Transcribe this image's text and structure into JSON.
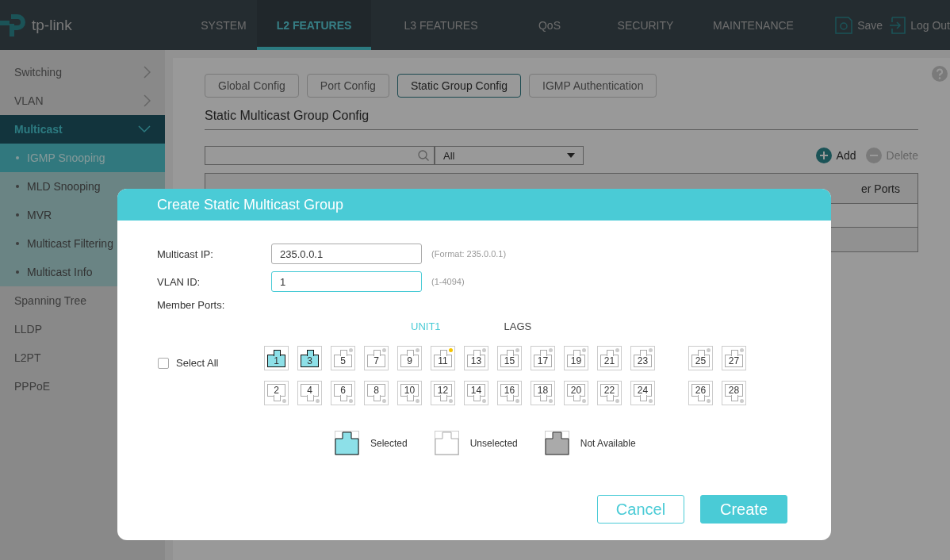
{
  "brand": "tp-link",
  "nav": [
    {
      "label": "SYSTEM",
      "selected": false
    },
    {
      "label": "L2 FEATURES",
      "selected": true
    },
    {
      "label": "L3 FEATURES",
      "selected": false
    },
    {
      "label": "QoS",
      "selected": false
    },
    {
      "label": "SECURITY",
      "selected": false
    },
    {
      "label": "MAINTENANCE",
      "selected": false
    }
  ],
  "header_actions": [
    {
      "kind": "save",
      "label": "Save"
    },
    {
      "kind": "logout",
      "label": "Log Out"
    }
  ],
  "sidebar": {
    "items": [
      {
        "label": "Switching",
        "expanded": false,
        "selected": false
      },
      {
        "label": "VLAN",
        "expanded": false,
        "selected": false
      },
      {
        "label": "Multicast",
        "expanded": true,
        "selected": true,
        "children": [
          {
            "label": "IGMP Snooping",
            "selected": true
          },
          {
            "label": "MLD Snooping",
            "selected": false
          },
          {
            "label": "MVR",
            "selected": false
          },
          {
            "label": "Multicast Filtering",
            "selected": false
          },
          {
            "label": "Multicast Info",
            "selected": false
          }
        ]
      },
      {
        "label": "Spanning Tree",
        "expanded": false,
        "selected": false
      },
      {
        "label": "LLDP",
        "expanded": false,
        "selected": false
      },
      {
        "label": "L2PT",
        "expanded": false,
        "selected": false
      },
      {
        "label": "PPPoE",
        "expanded": false,
        "selected": false
      }
    ]
  },
  "tabs": [
    {
      "label": "Global Config",
      "selected": false
    },
    {
      "label": "Port Config",
      "selected": false
    },
    {
      "label": "Static Group Config",
      "selected": true
    },
    {
      "label": "IGMP Authentication",
      "selected": false
    }
  ],
  "section_title": "Static Multicast Group Config",
  "filter": {
    "select_value": "All"
  },
  "table_actions": [
    {
      "kind": "add",
      "label": "Add",
      "disabled": false
    },
    {
      "kind": "delete",
      "label": "Delete",
      "disabled": true
    }
  ],
  "table": {
    "column_visible": "er Ports"
  },
  "dialog": {
    "title": "Create Static Multicast Group",
    "fields": [
      {
        "label": "Multicast IP:",
        "value": "235.0.0.1",
        "hint": "(Format: 235.0.0.1)",
        "focused": false
      },
      {
        "label": "VLAN ID:",
        "value": "1",
        "hint": "(1-4094)",
        "focused": true
      }
    ],
    "member_ports_label": "Member Ports:",
    "select_all": {
      "label": "Select All",
      "checked": false
    },
    "unit_label": "UNIT1",
    "lags_label": "LAGS",
    "ports": [
      {
        "label": "1",
        "selected": true,
        "link": false
      },
      {
        "label": "2",
        "selected": false,
        "link": false
      },
      {
        "label": "3",
        "selected": true,
        "link": false
      },
      {
        "label": "4",
        "selected": false,
        "link": false
      },
      {
        "label": "5",
        "selected": false,
        "link": false
      },
      {
        "label": "6",
        "selected": false,
        "link": false
      },
      {
        "label": "7",
        "selected": false,
        "link": false
      },
      {
        "label": "8",
        "selected": false,
        "link": false
      },
      {
        "label": "9",
        "selected": false,
        "link": false
      },
      {
        "label": "10",
        "selected": false,
        "link": false
      },
      {
        "label": "11",
        "selected": false,
        "link": true
      },
      {
        "label": "12",
        "selected": false,
        "link": false
      },
      {
        "label": "13",
        "selected": false,
        "link": false
      },
      {
        "label": "14",
        "selected": false,
        "link": false
      },
      {
        "label": "15",
        "selected": false,
        "link": false
      },
      {
        "label": "16",
        "selected": false,
        "link": false
      },
      {
        "label": "17",
        "selected": false,
        "link": false
      },
      {
        "label": "18",
        "selected": false,
        "link": false
      },
      {
        "label": "19",
        "selected": false,
        "link": false
      },
      {
        "label": "20",
        "selected": false,
        "link": false
      },
      {
        "label": "21",
        "selected": false,
        "link": false
      },
      {
        "label": "22",
        "selected": false,
        "link": false
      },
      {
        "label": "23",
        "selected": false,
        "link": false
      },
      {
        "label": "24",
        "selected": false,
        "link": false
      }
    ],
    "lags": [
      {
        "label": "25",
        "selected": false,
        "link": false
      },
      {
        "label": "26",
        "selected": false,
        "link": false
      },
      {
        "label": "27",
        "selected": false,
        "link": false
      },
      {
        "label": "28",
        "selected": false,
        "link": false
      }
    ],
    "legend": [
      {
        "kind": "selected",
        "label": "Selected"
      },
      {
        "kind": "unselected",
        "label": "Unselected"
      },
      {
        "kind": "unavailable",
        "label": "Not Available"
      }
    ],
    "buttons": [
      {
        "kind": "secondary",
        "label": "Cancel"
      },
      {
        "kind": "primary",
        "label": "Create"
      }
    ]
  }
}
